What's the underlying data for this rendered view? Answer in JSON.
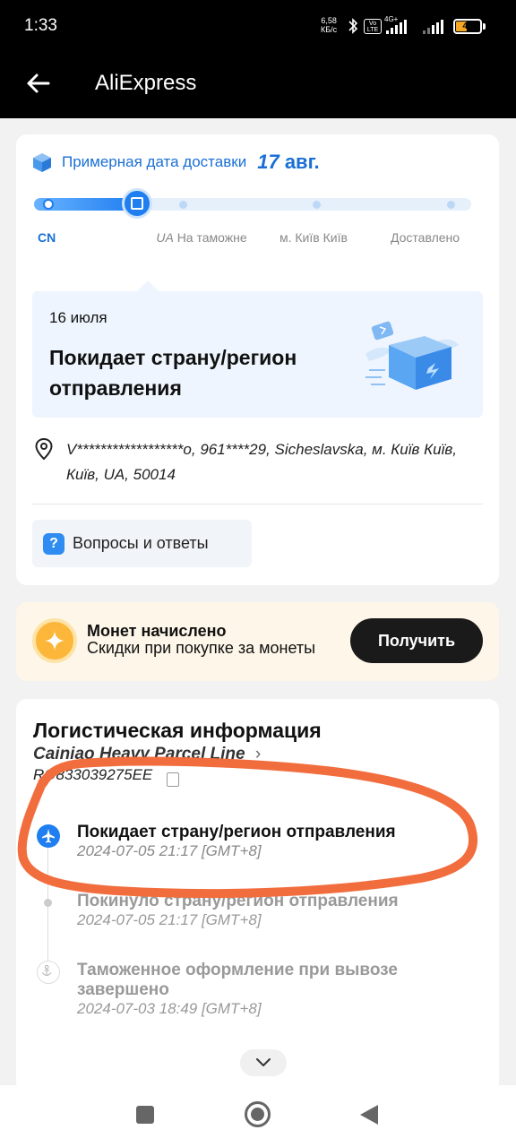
{
  "status_bar": {
    "time": "1:33",
    "net_speed": "6,58",
    "net_unit": "КБ/с",
    "volte": "Vo LTE",
    "network": "4G+",
    "battery": "41"
  },
  "app_bar": {
    "title": "AliExpress"
  },
  "delivery": {
    "eta_label": "Примерная дата доставки",
    "eta_day": "17",
    "eta_month": "авг.",
    "progress": 0.25,
    "steps": [
      {
        "code": "CN",
        "label": ""
      },
      {
        "code": "UA",
        "label": "На таможне"
      },
      {
        "code": "",
        "label": "м. Київ Київ"
      },
      {
        "code": "",
        "label": "Доставлено"
      }
    ],
    "latest": {
      "date": "16 июля",
      "status": "Покидает страну/регион отправления"
    },
    "address": "V******************o, 961****29, Sicheslavska, м. Київ Київ, Київ, UA, 50014",
    "qa_label": "Вопросы и ответы"
  },
  "coins": {
    "title": "Монет начислено",
    "subtitle": "Скидки при покупке за монеты",
    "button": "Получить"
  },
  "logistics": {
    "title": "Логистическая информация",
    "carrier": "Cainiao Heavy Parcel Line",
    "tracking_number": "RO833039275EE",
    "events": [
      {
        "title": "Покидает страну/регион отправления",
        "time": "2024-07-05 21:17 [GMT+8]",
        "state": "active"
      },
      {
        "title": "Покинуло страну/регион отправления",
        "time": "2024-07-05 21:17 [GMT+8]",
        "state": "past"
      },
      {
        "title": "Таможенное оформление при вывозе завершено",
        "time": "2024-07-03 18:49 [GMT+8]",
        "state": "past"
      }
    ]
  },
  "colors": {
    "accent": "#1f7ef0",
    "annotation": "#f26d3d",
    "coin": "#fcb63a"
  }
}
